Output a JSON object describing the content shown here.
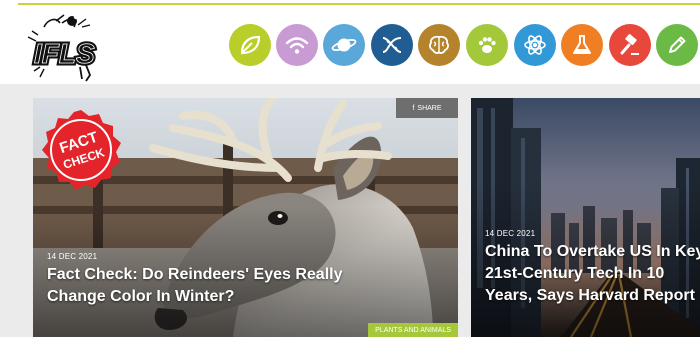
{
  "header": {
    "logo_text": "IFLS",
    "categories": [
      {
        "name": "environment",
        "icon": "leaf-icon",
        "color": "#b9cd2b"
      },
      {
        "name": "technology",
        "icon": "wifi-icon",
        "color": "#c99bd3"
      },
      {
        "name": "space",
        "icon": "planet-icon",
        "color": "#5aa7d9"
      },
      {
        "name": "health-and-medicine",
        "icon": "dna-icon",
        "color": "#1f5d93"
      },
      {
        "name": "brain",
        "icon": "brain-icon",
        "color": "#b5832c"
      },
      {
        "name": "plants-and-animals",
        "icon": "paw-icon",
        "color": "#a3c83a"
      },
      {
        "name": "physics",
        "icon": "atom-icon",
        "color": "#3399d6"
      },
      {
        "name": "chemistry",
        "icon": "flask-icon",
        "color": "#f07f24"
      },
      {
        "name": "editors-blog",
        "icon": "gavel-icon",
        "color": "#e8473b"
      },
      {
        "name": "editorial",
        "icon": "pencil-icon",
        "color": "#6aba45"
      }
    ]
  },
  "articles": [
    {
      "date": "14 DEC 2021",
      "title": "Fact Check: Do Reindeers' Eyes Really Change Color In Winter?",
      "category": "PLANTS AND ANIMALS",
      "share_label": "SHARE",
      "badge_text": "FACT CHECK"
    },
    {
      "date": "14 DEC 2021",
      "title": "China To Overtake US In Key 21st-Century Tech In 10 Years, Says Harvard Report"
    }
  ]
}
